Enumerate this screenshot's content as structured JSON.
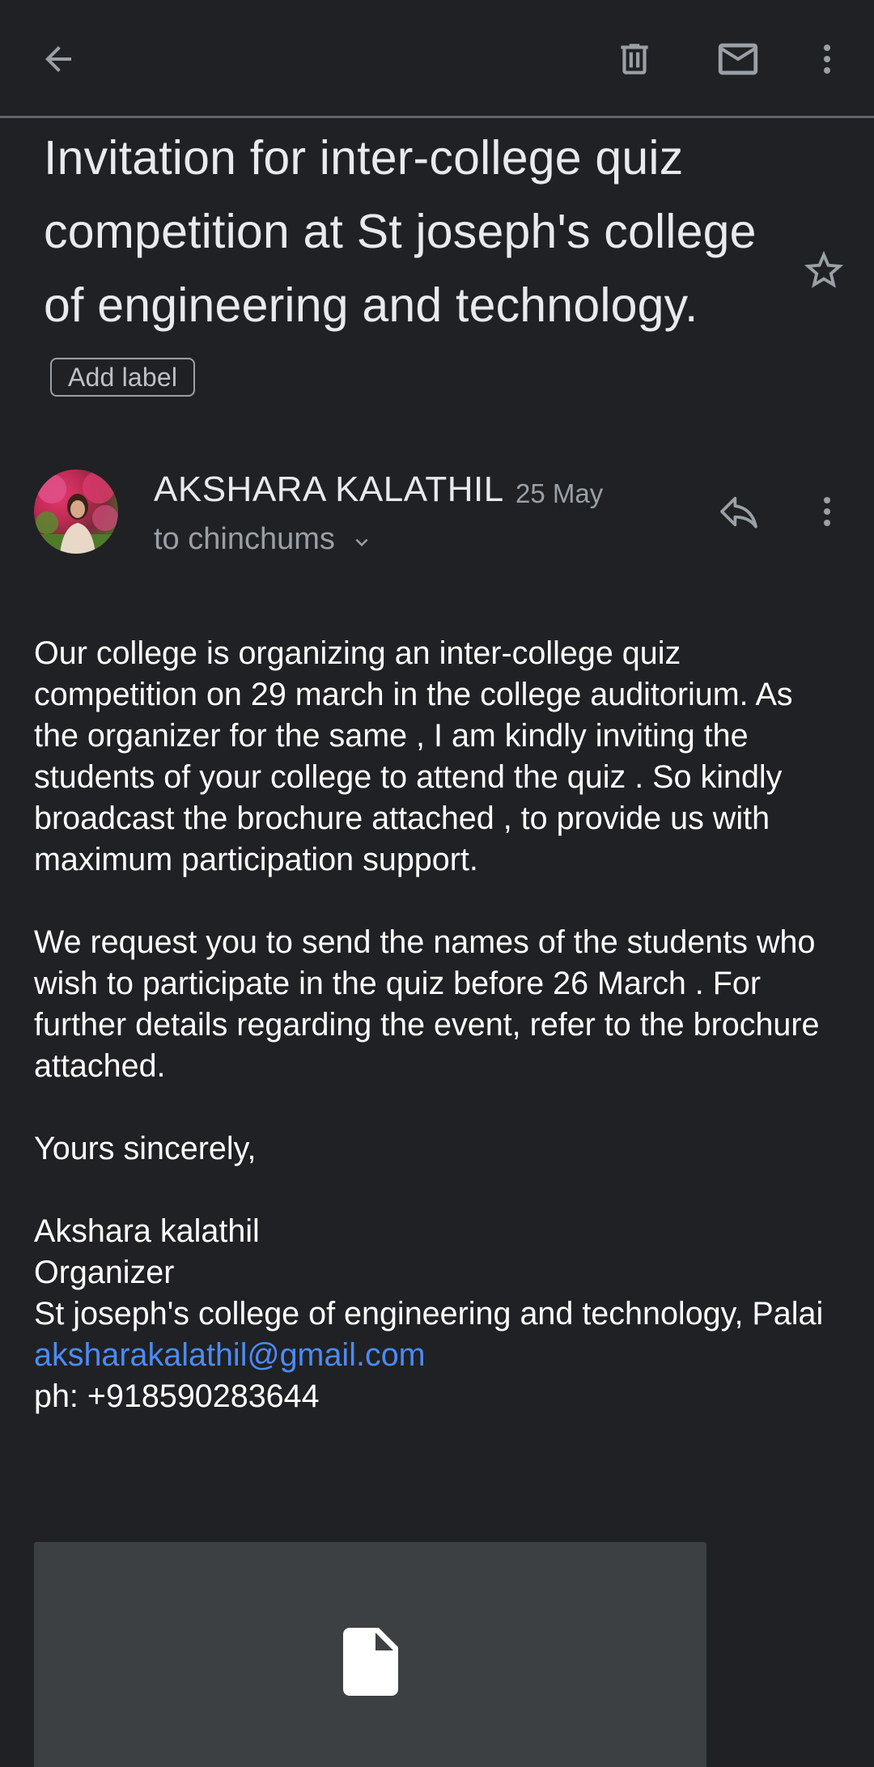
{
  "topbar": {
    "back_icon": "arrow-back-icon",
    "delete_icon": "trash-icon",
    "mark_unread_icon": "mail-icon",
    "more_icon": "more-vert-icon"
  },
  "email": {
    "subject": "Invitation for inter-college quiz competition at St joseph's college of engineering and technology.",
    "add_label": "Add label",
    "sender_name": "AKSHARA KALATHIL",
    "date": "25 May",
    "recipient": "to chinchums",
    "body": {
      "para1": "Our college is organizing an inter-college quiz competition on 29 march in the college auditorium. As the organizer for the same , I am kindly inviting the students of your college to attend the quiz . So kindly broadcast the brochure attached , to provide us with maximum participation support.",
      "para2": "We request you to send the names of the students who wish to participate in the quiz before 26 March . For further details regarding the event, refer to the brochure attached.",
      "closing": "Yours sincerely,",
      "sig_name": "Akshara kalathil",
      "sig_title": "Organizer",
      "sig_college": "St joseph's college of engineering and technology, Palai",
      "sig_email": "aksharakalathil@gmail.com",
      "sig_phone": "ph: +918590283644"
    }
  },
  "colors": {
    "background": "#202124",
    "link": "#4c8bf5",
    "attachment_bg": "#3c4043",
    "secondary_text": "#9aa0a6"
  }
}
